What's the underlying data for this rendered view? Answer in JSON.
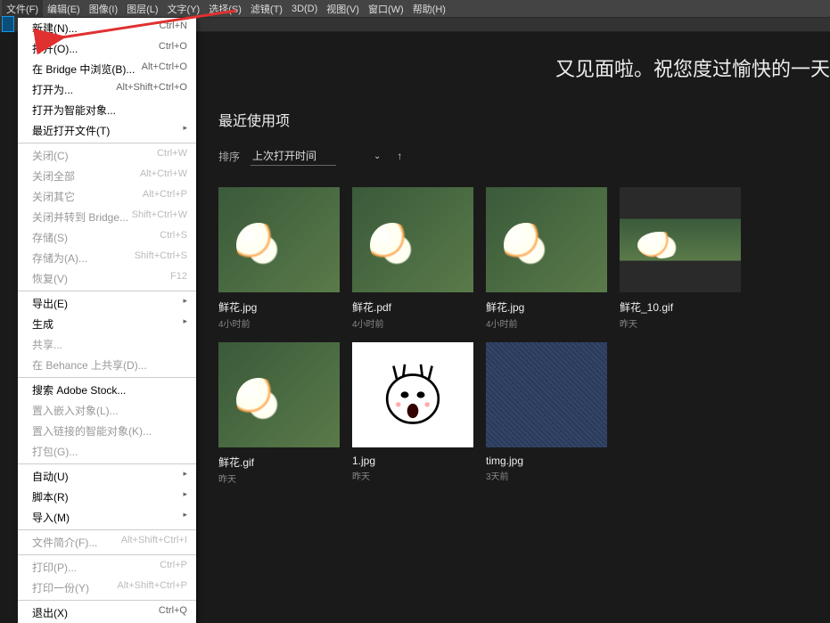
{
  "menubar": [
    {
      "label": "文件(F)"
    },
    {
      "label": "编辑(E)"
    },
    {
      "label": "图像(I)"
    },
    {
      "label": "图层(L)"
    },
    {
      "label": "文字(Y)"
    },
    {
      "label": "选择(S)"
    },
    {
      "label": "滤镜(T)"
    },
    {
      "label": "3D(D)"
    },
    {
      "label": "视图(V)"
    },
    {
      "label": "窗口(W)"
    },
    {
      "label": "帮助(H)"
    }
  ],
  "dropdown": [
    {
      "label": "新建(N)...",
      "shortcut": "Ctrl+N",
      "enabled": true
    },
    {
      "label": "打开(O)...",
      "shortcut": "Ctrl+O",
      "enabled": true
    },
    {
      "label": "在 Bridge 中浏览(B)...",
      "shortcut": "Alt+Ctrl+O",
      "enabled": true
    },
    {
      "label": "打开为...",
      "shortcut": "Alt+Shift+Ctrl+O",
      "enabled": true
    },
    {
      "label": "打开为智能对象...",
      "shortcut": "",
      "enabled": true
    },
    {
      "label": "最近打开文件(T)",
      "shortcut": "",
      "enabled": true,
      "submenu": true
    },
    {
      "sep": true
    },
    {
      "label": "关闭(C)",
      "shortcut": "Ctrl+W",
      "enabled": false
    },
    {
      "label": "关闭全部",
      "shortcut": "Alt+Ctrl+W",
      "enabled": false
    },
    {
      "label": "关闭其它",
      "shortcut": "Alt+Ctrl+P",
      "enabled": false
    },
    {
      "label": "关闭并转到 Bridge...",
      "shortcut": "Shift+Ctrl+W",
      "enabled": false
    },
    {
      "label": "存储(S)",
      "shortcut": "Ctrl+S",
      "enabled": false
    },
    {
      "label": "存储为(A)...",
      "shortcut": "Shift+Ctrl+S",
      "enabled": false
    },
    {
      "label": "恢复(V)",
      "shortcut": "F12",
      "enabled": false
    },
    {
      "sep": true
    },
    {
      "label": "导出(E)",
      "shortcut": "",
      "enabled": true,
      "submenu": true
    },
    {
      "label": "生成",
      "shortcut": "",
      "enabled": true,
      "submenu": true
    },
    {
      "label": "共享...",
      "shortcut": "",
      "enabled": false
    },
    {
      "label": "在 Behance 上共享(D)...",
      "shortcut": "",
      "enabled": false
    },
    {
      "sep": true
    },
    {
      "label": "搜索 Adobe Stock...",
      "shortcut": "",
      "enabled": true
    },
    {
      "label": "置入嵌入对象(L)...",
      "shortcut": "",
      "enabled": false
    },
    {
      "label": "置入链接的智能对象(K)...",
      "shortcut": "",
      "enabled": false
    },
    {
      "label": "打包(G)...",
      "shortcut": "",
      "enabled": false
    },
    {
      "sep": true
    },
    {
      "label": "自动(U)",
      "shortcut": "",
      "enabled": true,
      "submenu": true
    },
    {
      "label": "脚本(R)",
      "shortcut": "",
      "enabled": true,
      "submenu": true
    },
    {
      "label": "导入(M)",
      "shortcut": "",
      "enabled": true,
      "submenu": true
    },
    {
      "sep": true
    },
    {
      "label": "文件简介(F)...",
      "shortcut": "Alt+Shift+Ctrl+I",
      "enabled": false
    },
    {
      "sep": true
    },
    {
      "label": "打印(P)...",
      "shortcut": "Ctrl+P",
      "enabled": false
    },
    {
      "label": "打印一份(Y)",
      "shortcut": "Alt+Shift+Ctrl+P",
      "enabled": false
    },
    {
      "sep": true
    },
    {
      "label": "退出(X)",
      "shortcut": "Ctrl+Q",
      "enabled": true
    }
  ],
  "greeting": "又见面啦。祝您度过愉快的一天",
  "section_title": "最近使用项",
  "sort": {
    "label": "排序",
    "value": "上次打开时间"
  },
  "cards": [
    {
      "name": "鲜花.jpg",
      "time": "4小时前",
      "kind": "flower"
    },
    {
      "name": "鲜花.pdf",
      "time": "4小时前",
      "kind": "flower"
    },
    {
      "name": "鲜花.jpg",
      "time": "4小时前",
      "kind": "flower"
    },
    {
      "name": "鲜花_10.gif",
      "time": "昨天",
      "kind": "flower-narrow"
    },
    {
      "name": "鲜花.gif",
      "time": "昨天",
      "kind": "flower-partial"
    },
    {
      "name": "1.jpg",
      "time": "昨天",
      "kind": "face"
    },
    {
      "name": "timg.jpg",
      "time": "3天前",
      "kind": "texture"
    }
  ]
}
